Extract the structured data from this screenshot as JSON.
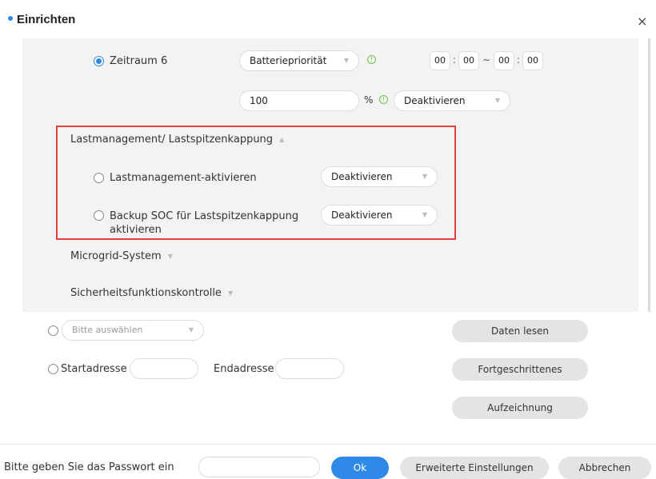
{
  "title": "Einrichten",
  "close_symbol": "×",
  "period": {
    "label": "Zeitraum 6",
    "priority_value": "Batteriepriorität",
    "start_hour": "00",
    "start_min": "00",
    "range_sep": "~",
    "end_hour": "00",
    "end_min": "00",
    "time_sep": ":",
    "percent_value": "100",
    "percent_unit": "%",
    "percent_select": "Deaktivieren"
  },
  "load_management": {
    "header": "Lastmanagement/ Lastspitzenkappung",
    "option1_label": "Lastmanagement-aktivieren",
    "option1_value": "Deaktivieren",
    "option2_label_line1": "Backup SOC für Lastspitzenkappung",
    "option2_label_line2": "aktivieren",
    "option2_value": "Deaktivieren"
  },
  "microgrid": {
    "header": "Microgrid-System"
  },
  "safety": {
    "header": "Sicherheitsfunktionskontrolle"
  },
  "lower": {
    "select_placeholder": "Bitte auswählen",
    "start_label": "Startadresse",
    "end_label": "Endadresse",
    "read_button": "Daten lesen",
    "advanced_button": "Fortgeschrittenes",
    "record_button": "Aufzeichnung"
  },
  "footer": {
    "password_label": "Bitte geben Sie das Passwort ein",
    "ok": "Ok",
    "extended": "Erweiterte Einstellungen",
    "cancel": "Abbrechen"
  },
  "icons": {
    "info": "info-icon",
    "dropdown": "chevron-down-icon",
    "collapse": "chevron-up-icon",
    "close": "close-icon"
  },
  "colors": {
    "accent": "#2e8ae6",
    "highlight": "#e0413a",
    "info": "#6cc24a",
    "panel": "#f3f3f3"
  }
}
